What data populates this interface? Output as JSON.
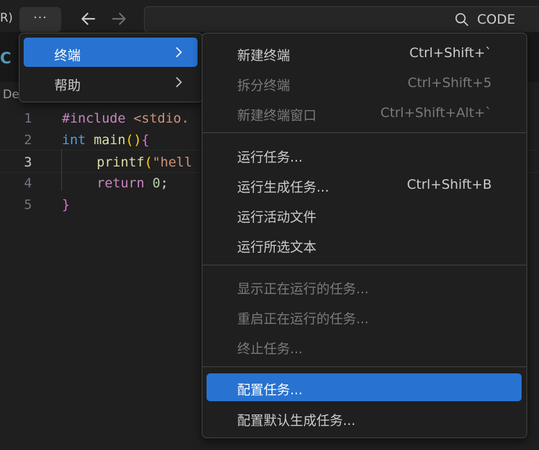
{
  "titlebar": {
    "left_partial_text": "R)",
    "more_label": "···",
    "search_text": "CODE"
  },
  "editor": {
    "tab_partial": "C",
    "breadcrumb_partial": "De",
    "lines": [
      {
        "num": "1"
      },
      {
        "num": "2"
      },
      {
        "num": "3"
      },
      {
        "num": "4"
      },
      {
        "num": "5"
      }
    ],
    "code": {
      "l1_kw": "#include",
      "l1_rest": " <stdio.",
      "l2_type": "int",
      "l2_fn": " main",
      "l2_open": "(){",
      "l2_paren": "()",
      "l2_brace": "{",
      "l3_fn": "printf",
      "l3_paren": "(",
      "l3_str": "\"hell",
      "l4_kw": "return",
      "l4_num": " 0",
      "l4_semi": ";",
      "l5_brace": "}"
    }
  },
  "main_menu": {
    "items": [
      {
        "label": "终端",
        "selected": true
      },
      {
        "label": "帮助",
        "selected": false
      }
    ]
  },
  "terminal_menu": {
    "items": [
      {
        "label": "新建终端",
        "shortcut": "Ctrl+Shift+`",
        "disabled": false
      },
      {
        "label": "拆分终端",
        "shortcut": "Ctrl+Shift+5",
        "disabled": true
      },
      {
        "label": "新建终端窗口",
        "shortcut": "Ctrl+Shift+Alt+`",
        "disabled": true
      },
      {
        "label": "运行任务...",
        "shortcut": "",
        "disabled": false
      },
      {
        "label": "运行生成任务...",
        "shortcut": "Ctrl+Shift+B",
        "disabled": false
      },
      {
        "label": "运行活动文件",
        "shortcut": "",
        "disabled": false
      },
      {
        "label": "运行所选文本",
        "shortcut": "",
        "disabled": false
      },
      {
        "label": "显示正在运行的任务...",
        "shortcut": "",
        "disabled": true
      },
      {
        "label": "重启正在运行的任务...",
        "shortcut": "",
        "disabled": true
      },
      {
        "label": "终止任务...",
        "shortcut": "",
        "disabled": true
      },
      {
        "label": "配置任务...",
        "shortcut": "",
        "disabled": false,
        "selected": true
      },
      {
        "label": "配置默认生成任务...",
        "shortcut": "",
        "disabled": false
      }
    ]
  },
  "colors": {
    "selection": "#2873d1",
    "background": "#1f1f1f",
    "menu_border": "#454545"
  }
}
